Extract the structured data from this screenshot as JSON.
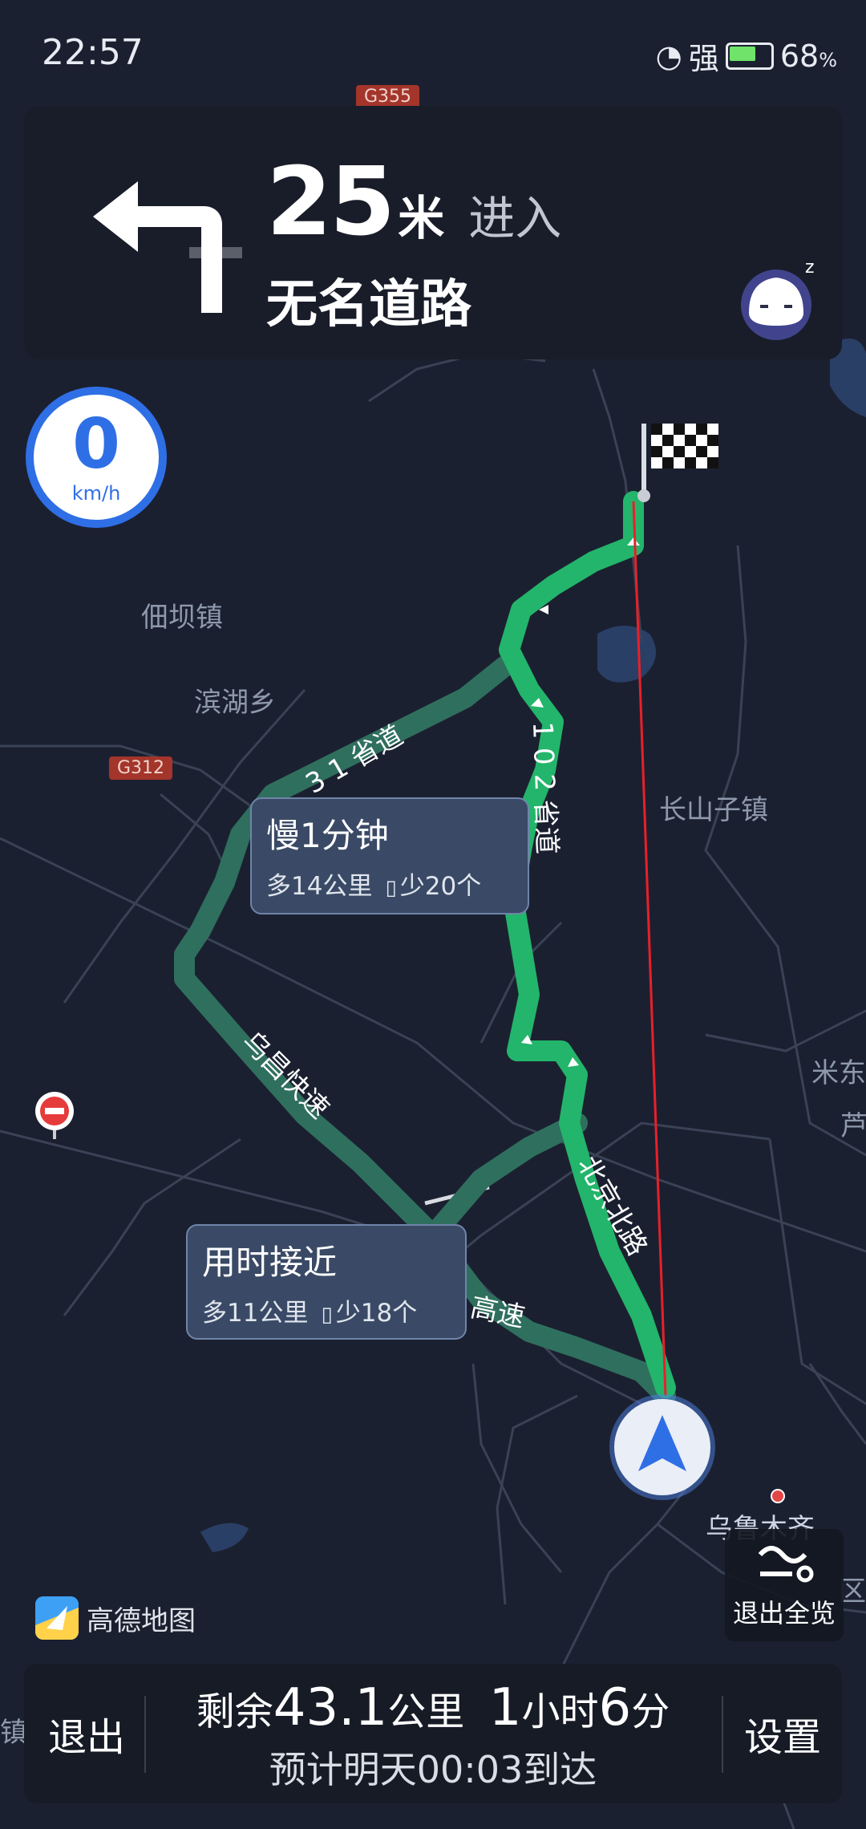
{
  "status_bar": {
    "time": "22:57",
    "signal": "强",
    "battery": "68",
    "battery_unit": "%"
  },
  "guidance": {
    "distance": "25",
    "unit": "米",
    "action": "进入",
    "road": "无名道路",
    "turn": "turn-left"
  },
  "speed": {
    "value": "0",
    "unit": "km/h"
  },
  "map": {
    "towns": [
      "佃坝镇",
      "滨湖乡",
      "长山子镇",
      "米东",
      "芦",
      "乌鲁木齐",
      "区",
      "镇"
    ],
    "badges": [
      "G355",
      "G312"
    ],
    "road_labels": [
      "3 1 省道",
      "1 0 2 省道",
      "乌昌快速",
      "北京北路",
      "高速"
    ]
  },
  "alt_routes": [
    {
      "title": "慢1分钟",
      "extra": "多14公里",
      "lights": "少20个"
    },
    {
      "title": "用时接近",
      "extra": "多11公里",
      "lights": "少18个"
    }
  ],
  "brand": "高德地图",
  "exit_overview": "退出全览",
  "bottom": {
    "exit": "退出",
    "remain_prefix": "剩余",
    "distance": "43.1",
    "distance_unit": "公里",
    "hours": "1",
    "hours_unit": "小时",
    "minutes": "6",
    "minutes_unit": "分",
    "eta": "预计明天00:03到达",
    "settings": "设置"
  },
  "colors": {
    "route": "#23b56b",
    "alt_route": "#2f6f5e",
    "speed_ring": "#2f6fe6",
    "straight_line": "#e8202a",
    "background": "#1b2030"
  }
}
